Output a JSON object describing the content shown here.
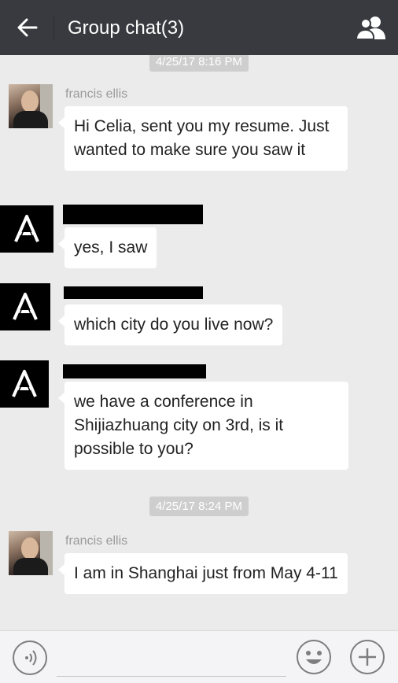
{
  "header": {
    "title": "Group chat(3)",
    "back_icon": "arrow-left-icon",
    "members_icon": "group-members-icon"
  },
  "messages": [
    {
      "timestamp": "4/25/17 8:16 PM"
    },
    {
      "sender": "francis ellis",
      "avatar": "photo",
      "text": "Hi Celia, sent you my resume. Just wanted to make sure you saw it"
    },
    {
      "sender": "",
      "avatar": "A-logo",
      "redacted": true,
      "text": "yes, I saw"
    },
    {
      "sender": "",
      "avatar": "A-logo",
      "redacted": true,
      "text": "which city do you live now?"
    },
    {
      "sender": "",
      "avatar": "A-logo",
      "redacted": true,
      "text": "we have a conference in Shijiazhuang city on 3rd, is it possible to you?"
    },
    {
      "timestamp": "4/25/17 8:24 PM"
    },
    {
      "sender": "francis ellis",
      "avatar": "photo",
      "text": "I am in Shanghai just from May 4-11"
    }
  ],
  "input_bar": {
    "voice_icon": "voice-icon",
    "input_value": "",
    "emoji_icon": "emoji-icon",
    "more_icon": "plus-icon"
  },
  "colors": {
    "header_bg": "#393a3f",
    "chat_bg": "#ebebeb",
    "bubble_bg": "#ffffff",
    "timestamp_bg": "#cecece"
  }
}
